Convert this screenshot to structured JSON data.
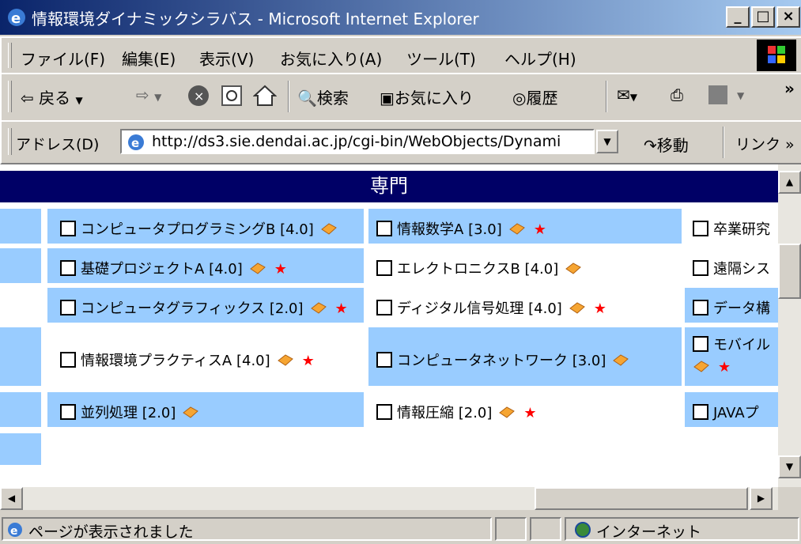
{
  "window": {
    "title": "情報環境ダイナミックシラバス - Microsoft Internet Explorer",
    "buttons": [
      "_",
      "□",
      "×"
    ]
  },
  "menu": [
    "ファイル(F)",
    "編集(E)",
    "表示(V)",
    "お気に入り(A)",
    "ツール(T)",
    "ヘルプ(H)"
  ],
  "toolbar": {
    "back": "戻る",
    "search": "検索",
    "favorites": "お気に入り",
    "history": "履歴",
    "more": "»"
  },
  "address": {
    "label": "アドレス(D)",
    "url": "http://ds3.sie.dendai.ac.jp/cgi-bin/WebObjects/Dynami",
    "go": "移動",
    "links": "リンク »"
  },
  "content": {
    "section_title": "専門",
    "rows": [
      [
        {
          "name": "コンピュータプログラミングB",
          "credits": "[4.0]",
          "star": false
        },
        {
          "name": "情報数学A",
          "credits": "[3.0]",
          "star": true
        },
        {
          "name": "卒業研究",
          "credits": "",
          "star": false
        }
      ],
      [
        {
          "name": "基礎プロジェクトA",
          "credits": "[4.0]",
          "star": true
        },
        {
          "name": "エレクトロニクスB",
          "credits": "[4.0]",
          "star": false
        },
        {
          "name": "遠隔シス",
          "credits": "",
          "star": false
        }
      ],
      [
        {
          "name": "コンピュータグラフィックス",
          "credits": "[2.0]",
          "star": true
        },
        {
          "name": "ディジタル信号処理",
          "credits": "[4.0]",
          "star": true
        },
        {
          "name": "データ構",
          "credits": "",
          "star": false
        }
      ],
      [
        {
          "name": "情報環境プラクティスA",
          "credits": "[4.0]",
          "star": true
        },
        {
          "name": "コンピュータネットワーク",
          "credits": "[3.0]",
          "star": false
        },
        {
          "name": "モバイル",
          "credits": "",
          "star": true
        }
      ],
      [
        {
          "name": "並列処理",
          "credits": "[2.0]",
          "star": false
        },
        {
          "name": "情報圧縮",
          "credits": "[2.0]",
          "star": true
        },
        {
          "name": "JAVAプ",
          "credits": "",
          "star": false
        }
      ]
    ]
  },
  "status": {
    "text": "ページが表示されました",
    "zone": "インターネット"
  },
  "colors": {
    "row_blue": "#99ccff",
    "header": "#000066",
    "title_start": "#0a246a",
    "title_end": "#a6caf0"
  }
}
